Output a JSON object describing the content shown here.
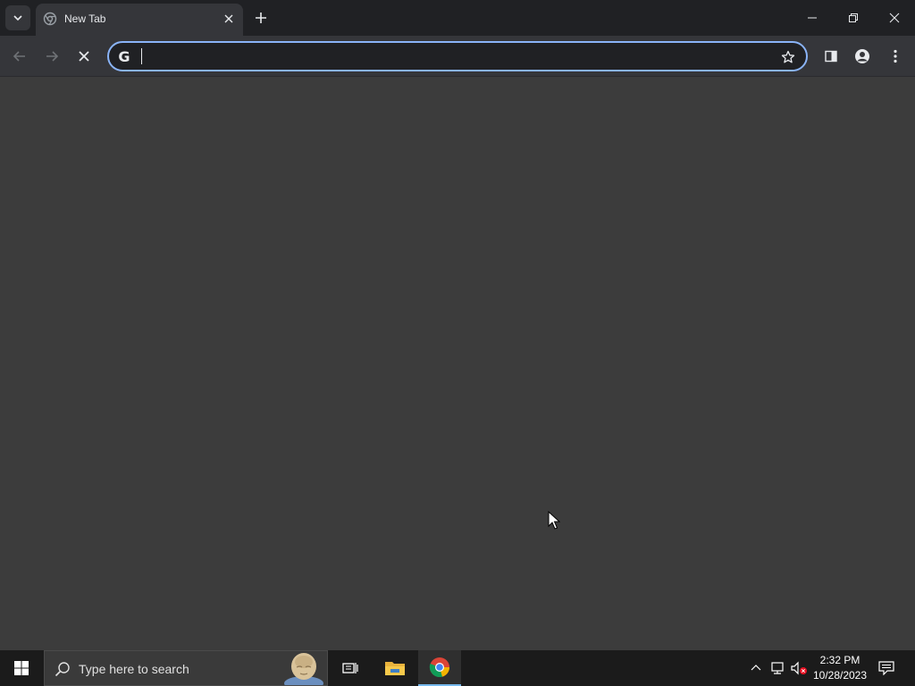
{
  "browser": {
    "tab": {
      "title": "New Tab",
      "favicon": "chrome-loading-icon"
    },
    "toolbar": {
      "back_icon": "back-arrow-icon",
      "forward_icon": "forward-arrow-icon",
      "stop_icon": "stop-x-icon",
      "omnibox": {
        "value": "",
        "placeholder": "",
        "leading_icon": "G"
      },
      "bookmark_icon": "star-icon",
      "side_panel_icon": "side-panel-icon",
      "profile_icon": "profile-icon",
      "menu_icon": "kebab-menu-icon"
    },
    "window_controls": [
      "minimize-icon",
      "restore-icon",
      "close-icon"
    ]
  },
  "taskbar": {
    "search": {
      "placeholder": "Type here to search"
    },
    "apps": [
      "task-view-icon",
      "file-explorer-icon",
      "chrome-icon"
    ],
    "clock": {
      "time": "2:32 PM",
      "date": "10/28/2023"
    }
  },
  "colors": {
    "tabstrip": "#202124",
    "toolbar": "#35363a",
    "content": "#3c3c3c",
    "accent": "#8ab4f8",
    "taskbar": "#1b1b1b"
  }
}
